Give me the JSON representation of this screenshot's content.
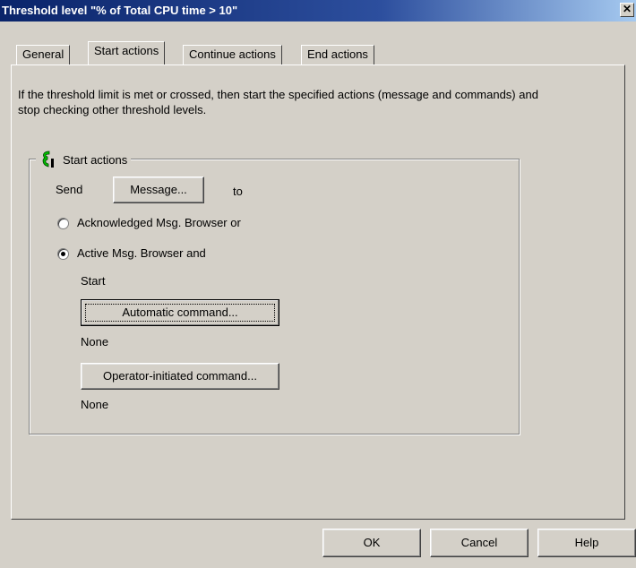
{
  "window": {
    "title": "Threshold level \"% of Total CPU time > 10\"",
    "close_label": "✕"
  },
  "tabs": [
    {
      "label": "General"
    },
    {
      "label": "Start actions"
    },
    {
      "label": "Continue actions"
    },
    {
      "label": "End actions"
    }
  ],
  "active_tab": "Start actions",
  "description": "If the threshold limit is met or crossed, then start the specified actions (message and commands) and stop checking other threshold levels.",
  "group": {
    "title": "Start actions",
    "icon": "start-actions-icon",
    "send_label": "Send",
    "message_button": "Message...",
    "to_label": "to",
    "radio_options": [
      {
        "label": "Acknowledged Msg. Browser or",
        "selected": false
      },
      {
        "label": "Active Msg. Browser and",
        "selected": true
      }
    ],
    "start_label": "Start",
    "auto_command_button": "Automatic command...",
    "auto_command_value": "None",
    "operator_command_button": "Operator-initiated command...",
    "operator_command_value": "None"
  },
  "footer": {
    "ok": "OK",
    "cancel": "Cancel",
    "help": "Help"
  },
  "colors": {
    "icon_green": "#00c000",
    "titlebar": "#0a246a"
  }
}
